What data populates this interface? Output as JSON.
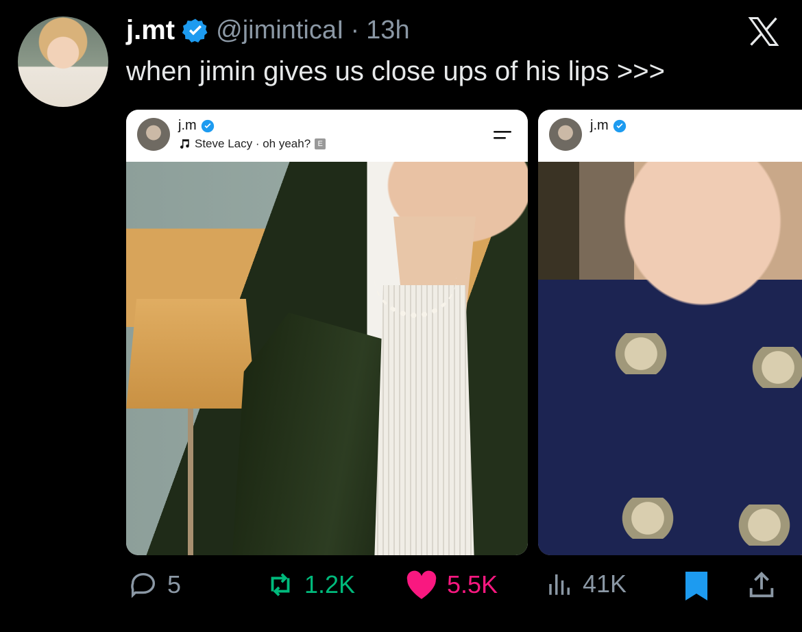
{
  "tweet": {
    "display_name": "j.mt",
    "handle": "@jiminticaI",
    "separator": "·",
    "time": "13h",
    "text": "when jimin gives us close ups of his lips >>>"
  },
  "embedded_cards": [
    {
      "name": "j.m",
      "song": "Steve Lacy · oh yeah?",
      "explicit_label": "E"
    },
    {
      "name": "j.m"
    }
  ],
  "actions": {
    "replies": "5",
    "retweets": "1.2K",
    "likes": "5.5K",
    "views": "41K"
  },
  "colors": {
    "background": "#000000",
    "verified": "#1d9bf0",
    "retweet": "#00ba7c",
    "like": "#f91880",
    "bookmark": "#1d9bf0",
    "muted": "#8b98a5"
  },
  "icons": [
    "x-logo-icon",
    "verified-badge-icon",
    "music-note-icon",
    "menu-icon",
    "reply-icon",
    "retweet-icon",
    "heart-icon",
    "views-icon",
    "bookmark-icon",
    "share-icon"
  ]
}
